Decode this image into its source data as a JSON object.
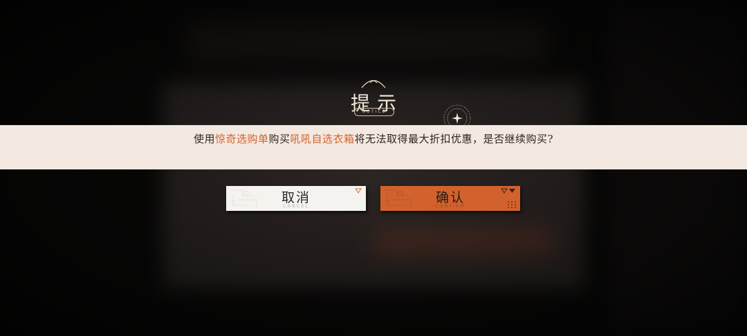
{
  "dialog": {
    "title": "提示",
    "title_sub": "NOTICE",
    "message_parts": [
      {
        "text": "使用",
        "highlight": false
      },
      {
        "text": "惊奇选购单",
        "highlight": true
      },
      {
        "text": "购买",
        "highlight": false
      },
      {
        "text": "吼吼自选衣箱",
        "highlight": true
      },
      {
        "text": "将无法取得最大折扣优惠，是否继续购买?",
        "highlight": false
      }
    ],
    "highlight_color": "#d6622a"
  },
  "buttons": {
    "cancel": {
      "label": "取消",
      "sub": "CANCEL"
    },
    "confirm": {
      "label": "确认",
      "sub": "CONFIRM"
    }
  },
  "colors": {
    "banner": "#f3e9e1",
    "confirm_button": "#d2622d",
    "cancel_button": "#f5f3f0"
  }
}
